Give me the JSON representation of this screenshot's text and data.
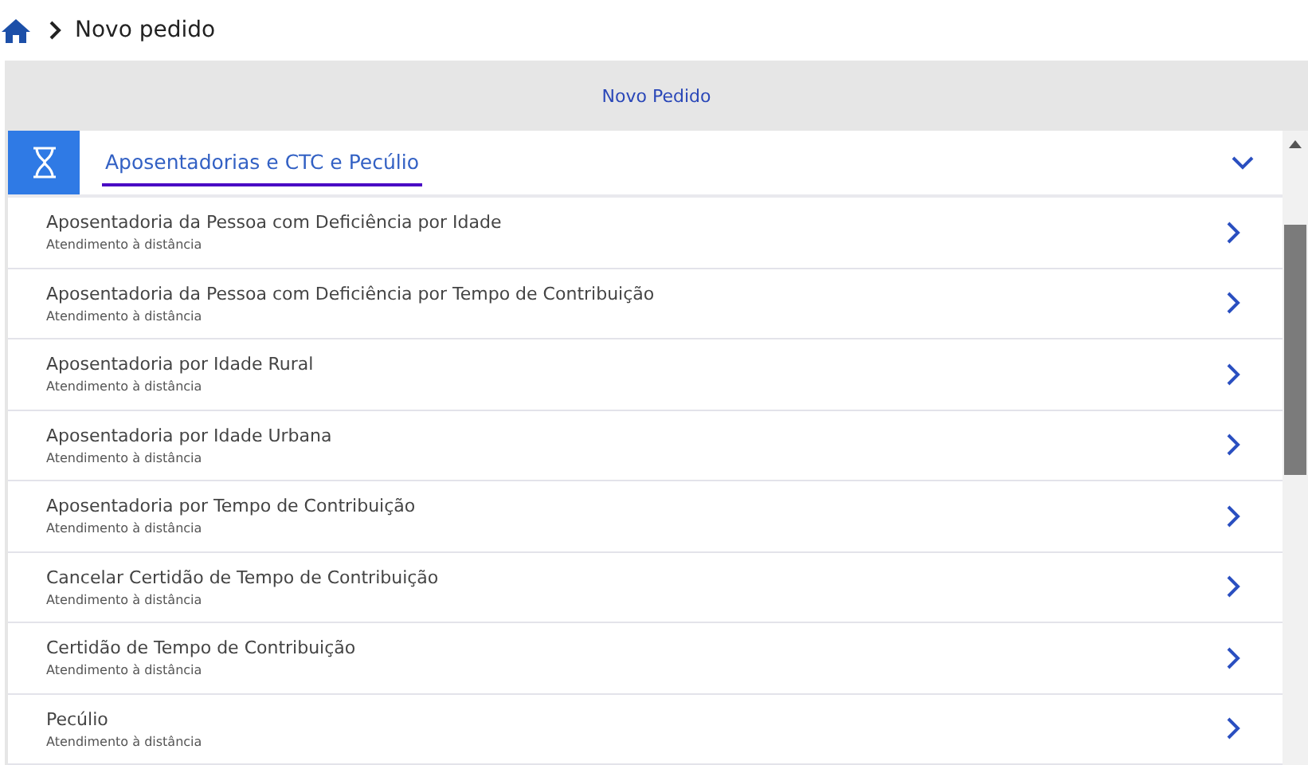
{
  "breadcrumb": {
    "current": "Novo pedido"
  },
  "panel": {
    "title": "Novo Pedido"
  },
  "section": {
    "title": "Aposentadorias e CTC e Pecúlio",
    "expanded": true
  },
  "services": [
    {
      "title": "Aposentadoria da Pessoa com Deficiência por Idade",
      "subtitle": "Atendimento à distância"
    },
    {
      "title": "Aposentadoria da Pessoa com Deficiência por Tempo de Contribuição",
      "subtitle": "Atendimento à distância"
    },
    {
      "title": "Aposentadoria por Idade Rural",
      "subtitle": "Atendimento à distância"
    },
    {
      "title": "Aposentadoria por Idade Urbana",
      "subtitle": "Atendimento à distância"
    },
    {
      "title": "Aposentadoria por Tempo de Contribuição",
      "subtitle": "Atendimento à distância"
    },
    {
      "title": "Cancelar Certidão de Tempo de Contribuição",
      "subtitle": "Atendimento à distância"
    },
    {
      "title": "Certidão de Tempo de Contribuição",
      "subtitle": "Atendimento à distância"
    },
    {
      "title": "Pecúlio",
      "subtitle": "Atendimento à distância"
    }
  ]
}
